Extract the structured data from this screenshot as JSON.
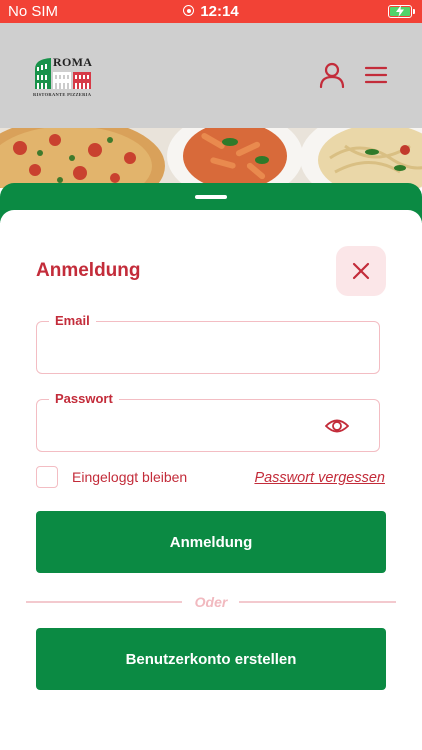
{
  "status_bar": {
    "carrier": "No SIM",
    "time": "12:14"
  },
  "header": {
    "logo_title": "ROMA",
    "logo_subtitle": "RISTORANTE PIZZERIA",
    "icons": [
      "user-icon",
      "menu-icon"
    ]
  },
  "login": {
    "title": "Anmeldung",
    "email_label": "Email",
    "email_value": "",
    "password_label": "Passwort",
    "password_value": "",
    "stay_logged_in": "Eingeloggt bleiben",
    "forgot_password": "Passwort vergessen",
    "login_button": "Anmeldung",
    "or_text": "Oder",
    "register_button": "Benutzerkonto erstellen"
  },
  "colors": {
    "status_bar": "#f24236",
    "accent_red": "#c32c3a",
    "brand_green": "#0b8a43",
    "light_pink": "#fbe6e8"
  }
}
